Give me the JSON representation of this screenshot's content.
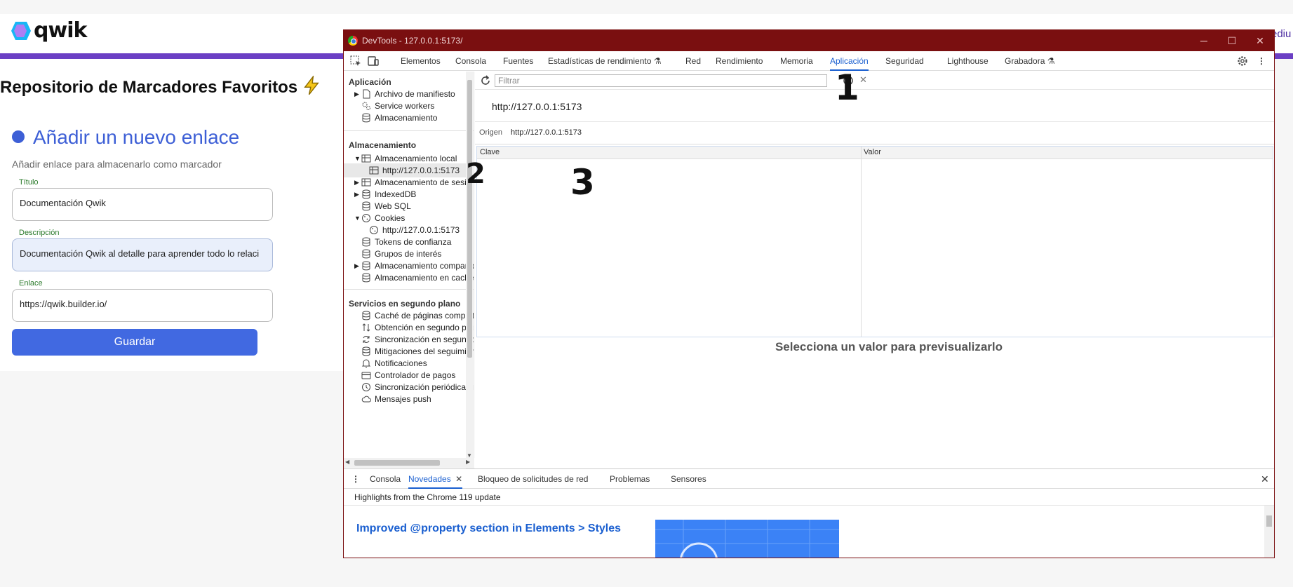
{
  "app": {
    "logo_text": "qwik",
    "edge_text": "ediu",
    "title": "Repositorio de Marcadores Favoritos",
    "add_title": "Añadir un nuevo enlace",
    "add_subtitle": "Añadir enlace para almacenarlo como marcador",
    "fields": [
      {
        "label": "Título",
        "value": "Documentación Qwik"
      },
      {
        "label": "Descripción",
        "value": "Documentación Qwik al detalle para aprender todo lo relaci"
      },
      {
        "label": "Enlace",
        "value": "https://qwik.builder.io/"
      }
    ],
    "save_label": "Guardar",
    "brand_color": "#4169e1",
    "header_accent": "#6b3fc4"
  },
  "devtools": {
    "window_title": "DevTools - 127.0.0.1:5173/",
    "titlebar_color": "#7a0f10",
    "tabs": [
      {
        "label": "Elementos"
      },
      {
        "label": "Consola"
      },
      {
        "label": "Fuentes"
      },
      {
        "label": "Estadísticas de rendimiento"
      },
      {
        "label": "Red"
      },
      {
        "label": "Rendimiento"
      },
      {
        "label": "Memoria"
      },
      {
        "label": "Aplicación"
      },
      {
        "label": "Seguridad"
      },
      {
        "label": "Lighthouse"
      },
      {
        "label": "Grabadora"
      }
    ],
    "active_tab": "Aplicación",
    "sidebar": {
      "app_section": "Aplicación",
      "app_items": [
        "Archivo de manifiesto",
        "Service workers",
        "Almacenamiento"
      ],
      "storage_section": "Almacenamiento",
      "storage_items": [
        "Almacenamiento local",
        "http://127.0.0.1:5173",
        "Almacenamiento de sesión",
        "IndexedDB",
        "Web SQL",
        "Cookies",
        "http://127.0.0.1:5173",
        "Tokens de confianza",
        "Grupos de interés",
        "Almacenamiento compartido",
        "Almacenamiento en caché"
      ],
      "bg_section": "Servicios en segundo plano",
      "bg_items": [
        "Caché de páginas completas",
        "Obtención en segundo plano",
        "Sincronización en segundo p",
        "Mitigaciones del seguimiento",
        "Notificaciones",
        "Controlador de pagos",
        "Sincronización periódica en s",
        "Mensajes push"
      ]
    },
    "filter_placeholder": "Filtrar",
    "url": "http://127.0.0.1:5173",
    "origin_label": "Origen",
    "origin_value": "http://127.0.0.1:5173",
    "columns": [
      "Clave",
      "Valor"
    ],
    "preview_text": "Selecciona un valor para previsualizarlo",
    "drawer": {
      "tabs": [
        "Consola",
        "Novedades",
        "Bloqueo de solicitudes de red",
        "Problemas",
        "Sensores"
      ],
      "active_tab": "Novedades",
      "highlights": "Highlights from the Chrome 119 update",
      "headline": "Improved @property section in Elements > Styles"
    }
  },
  "annotations": [
    "1",
    "2",
    "3"
  ]
}
